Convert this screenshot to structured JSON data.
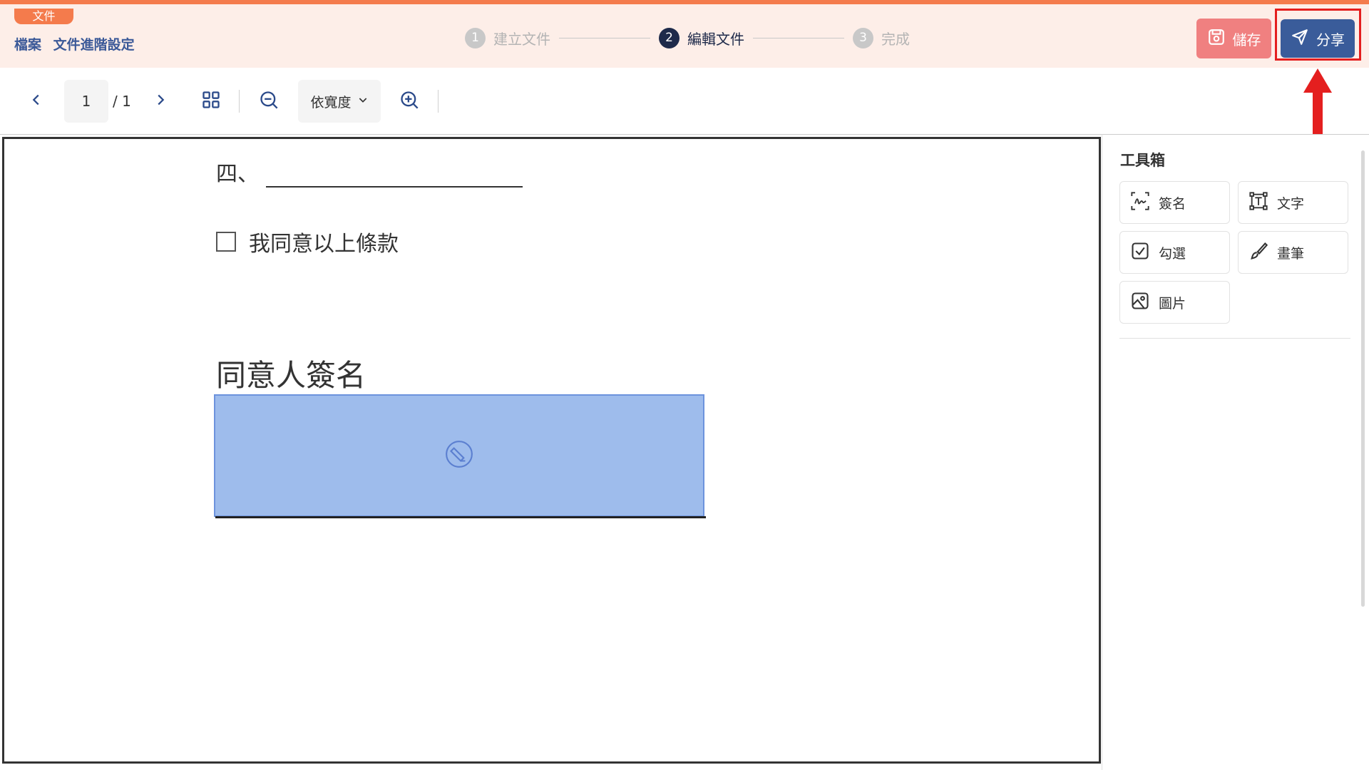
{
  "header": {
    "file_tag": "文件",
    "breadcrumb": [
      "檔案",
      "文件進階設定"
    ],
    "steps": [
      {
        "num": "1",
        "label": "建立文件"
      },
      {
        "num": "2",
        "label": "編輯文件"
      },
      {
        "num": "3",
        "label": "完成"
      }
    ],
    "active_step": 2,
    "save_label": "儲存",
    "share_label": "分享"
  },
  "toolbar": {
    "page_current": "1",
    "page_total": "/ 1",
    "zoom_mode": "依寬度"
  },
  "document": {
    "line4_label": "四、",
    "checkbox_text": "我同意以上條款",
    "sign_title": "同意人簽名"
  },
  "toolbox": {
    "title": "工具箱",
    "tools": [
      {
        "label": "簽名",
        "icon": "signature-icon"
      },
      {
        "label": "文字",
        "icon": "text-box-icon"
      },
      {
        "label": "勾選",
        "icon": "checkbox-icon"
      },
      {
        "label": "畫筆",
        "icon": "brush-icon"
      },
      {
        "label": "圖片",
        "icon": "image-icon"
      }
    ]
  },
  "colors": {
    "accent_orange": "#f47b4c",
    "header_bg": "#fdeee8",
    "save_button": "#f08080",
    "share_button": "#3a5c9a",
    "sign_field": "#9ebcec",
    "annotation_red": "#e41f1f"
  }
}
